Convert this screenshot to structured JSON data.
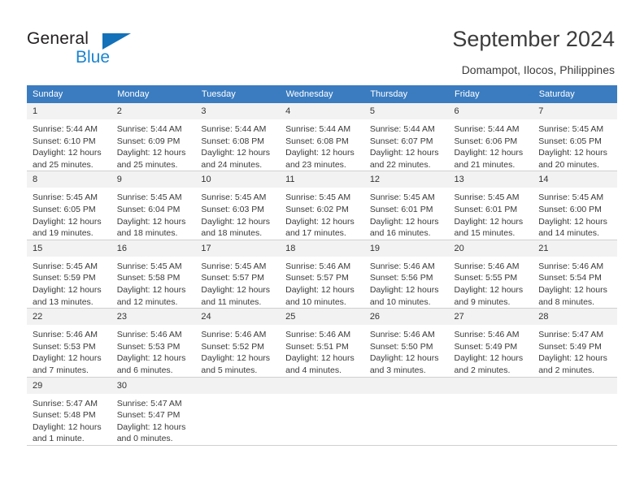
{
  "brand": {
    "name_part1": "General",
    "name_part2": "Blue",
    "triangle_color": "#1271b8",
    "blue_text_color": "#1b84d0"
  },
  "header": {
    "title": "September 2024",
    "subtitle": "Domampot, Ilocos, Philippines",
    "header_bg_color": "#3b7cc0",
    "daynum_bg_color": "#f2f2f2"
  },
  "calendar": {
    "weekday_headers": [
      "Sunday",
      "Monday",
      "Tuesday",
      "Wednesday",
      "Thursday",
      "Friday",
      "Saturday"
    ],
    "weeks": [
      [
        {
          "day": "1",
          "sunrise": "Sunrise: 5:44 AM",
          "sunset": "Sunset: 6:10 PM",
          "daylight_1": "Daylight: 12 hours",
          "daylight_2": "and 25 minutes."
        },
        {
          "day": "2",
          "sunrise": "Sunrise: 5:44 AM",
          "sunset": "Sunset: 6:09 PM",
          "daylight_1": "Daylight: 12 hours",
          "daylight_2": "and 25 minutes."
        },
        {
          "day": "3",
          "sunrise": "Sunrise: 5:44 AM",
          "sunset": "Sunset: 6:08 PM",
          "daylight_1": "Daylight: 12 hours",
          "daylight_2": "and 24 minutes."
        },
        {
          "day": "4",
          "sunrise": "Sunrise: 5:44 AM",
          "sunset": "Sunset: 6:08 PM",
          "daylight_1": "Daylight: 12 hours",
          "daylight_2": "and 23 minutes."
        },
        {
          "day": "5",
          "sunrise": "Sunrise: 5:44 AM",
          "sunset": "Sunset: 6:07 PM",
          "daylight_1": "Daylight: 12 hours",
          "daylight_2": "and 22 minutes."
        },
        {
          "day": "6",
          "sunrise": "Sunrise: 5:44 AM",
          "sunset": "Sunset: 6:06 PM",
          "daylight_1": "Daylight: 12 hours",
          "daylight_2": "and 21 minutes."
        },
        {
          "day": "7",
          "sunrise": "Sunrise: 5:45 AM",
          "sunset": "Sunset: 6:05 PM",
          "daylight_1": "Daylight: 12 hours",
          "daylight_2": "and 20 minutes."
        }
      ],
      [
        {
          "day": "8",
          "sunrise": "Sunrise: 5:45 AM",
          "sunset": "Sunset: 6:05 PM",
          "daylight_1": "Daylight: 12 hours",
          "daylight_2": "and 19 minutes."
        },
        {
          "day": "9",
          "sunrise": "Sunrise: 5:45 AM",
          "sunset": "Sunset: 6:04 PM",
          "daylight_1": "Daylight: 12 hours",
          "daylight_2": "and 18 minutes."
        },
        {
          "day": "10",
          "sunrise": "Sunrise: 5:45 AM",
          "sunset": "Sunset: 6:03 PM",
          "daylight_1": "Daylight: 12 hours",
          "daylight_2": "and 18 minutes."
        },
        {
          "day": "11",
          "sunrise": "Sunrise: 5:45 AM",
          "sunset": "Sunset: 6:02 PM",
          "daylight_1": "Daylight: 12 hours",
          "daylight_2": "and 17 minutes."
        },
        {
          "day": "12",
          "sunrise": "Sunrise: 5:45 AM",
          "sunset": "Sunset: 6:01 PM",
          "daylight_1": "Daylight: 12 hours",
          "daylight_2": "and 16 minutes."
        },
        {
          "day": "13",
          "sunrise": "Sunrise: 5:45 AM",
          "sunset": "Sunset: 6:01 PM",
          "daylight_1": "Daylight: 12 hours",
          "daylight_2": "and 15 minutes."
        },
        {
          "day": "14",
          "sunrise": "Sunrise: 5:45 AM",
          "sunset": "Sunset: 6:00 PM",
          "daylight_1": "Daylight: 12 hours",
          "daylight_2": "and 14 minutes."
        }
      ],
      [
        {
          "day": "15",
          "sunrise": "Sunrise: 5:45 AM",
          "sunset": "Sunset: 5:59 PM",
          "daylight_1": "Daylight: 12 hours",
          "daylight_2": "and 13 minutes."
        },
        {
          "day": "16",
          "sunrise": "Sunrise: 5:45 AM",
          "sunset": "Sunset: 5:58 PM",
          "daylight_1": "Daylight: 12 hours",
          "daylight_2": "and 12 minutes."
        },
        {
          "day": "17",
          "sunrise": "Sunrise: 5:45 AM",
          "sunset": "Sunset: 5:57 PM",
          "daylight_1": "Daylight: 12 hours",
          "daylight_2": "and 11 minutes."
        },
        {
          "day": "18",
          "sunrise": "Sunrise: 5:46 AM",
          "sunset": "Sunset: 5:57 PM",
          "daylight_1": "Daylight: 12 hours",
          "daylight_2": "and 10 minutes."
        },
        {
          "day": "19",
          "sunrise": "Sunrise: 5:46 AM",
          "sunset": "Sunset: 5:56 PM",
          "daylight_1": "Daylight: 12 hours",
          "daylight_2": "and 10 minutes."
        },
        {
          "day": "20",
          "sunrise": "Sunrise: 5:46 AM",
          "sunset": "Sunset: 5:55 PM",
          "daylight_1": "Daylight: 12 hours",
          "daylight_2": "and 9 minutes."
        },
        {
          "day": "21",
          "sunrise": "Sunrise: 5:46 AM",
          "sunset": "Sunset: 5:54 PM",
          "daylight_1": "Daylight: 12 hours",
          "daylight_2": "and 8 minutes."
        }
      ],
      [
        {
          "day": "22",
          "sunrise": "Sunrise: 5:46 AM",
          "sunset": "Sunset: 5:53 PM",
          "daylight_1": "Daylight: 12 hours",
          "daylight_2": "and 7 minutes."
        },
        {
          "day": "23",
          "sunrise": "Sunrise: 5:46 AM",
          "sunset": "Sunset: 5:53 PM",
          "daylight_1": "Daylight: 12 hours",
          "daylight_2": "and 6 minutes."
        },
        {
          "day": "24",
          "sunrise": "Sunrise: 5:46 AM",
          "sunset": "Sunset: 5:52 PM",
          "daylight_1": "Daylight: 12 hours",
          "daylight_2": "and 5 minutes."
        },
        {
          "day": "25",
          "sunrise": "Sunrise: 5:46 AM",
          "sunset": "Sunset: 5:51 PM",
          "daylight_1": "Daylight: 12 hours",
          "daylight_2": "and 4 minutes."
        },
        {
          "day": "26",
          "sunrise": "Sunrise: 5:46 AM",
          "sunset": "Sunset: 5:50 PM",
          "daylight_1": "Daylight: 12 hours",
          "daylight_2": "and 3 minutes."
        },
        {
          "day": "27",
          "sunrise": "Sunrise: 5:46 AM",
          "sunset": "Sunset: 5:49 PM",
          "daylight_1": "Daylight: 12 hours",
          "daylight_2": "and 2 minutes."
        },
        {
          "day": "28",
          "sunrise": "Sunrise: 5:47 AM",
          "sunset": "Sunset: 5:49 PM",
          "daylight_1": "Daylight: 12 hours",
          "daylight_2": "and 2 minutes."
        }
      ],
      [
        {
          "day": "29",
          "sunrise": "Sunrise: 5:47 AM",
          "sunset": "Sunset: 5:48 PM",
          "daylight_1": "Daylight: 12 hours",
          "daylight_2": "and 1 minute."
        },
        {
          "day": "30",
          "sunrise": "Sunrise: 5:47 AM",
          "sunset": "Sunset: 5:47 PM",
          "daylight_1": "Daylight: 12 hours",
          "daylight_2": "and 0 minutes."
        },
        {
          "day": "",
          "sunrise": "",
          "sunset": "",
          "daylight_1": "",
          "daylight_2": ""
        },
        {
          "day": "",
          "sunrise": "",
          "sunset": "",
          "daylight_1": "",
          "daylight_2": ""
        },
        {
          "day": "",
          "sunrise": "",
          "sunset": "",
          "daylight_1": "",
          "daylight_2": ""
        },
        {
          "day": "",
          "sunrise": "",
          "sunset": "",
          "daylight_1": "",
          "daylight_2": ""
        },
        {
          "day": "",
          "sunrise": "",
          "sunset": "",
          "daylight_1": "",
          "daylight_2": ""
        }
      ]
    ]
  }
}
